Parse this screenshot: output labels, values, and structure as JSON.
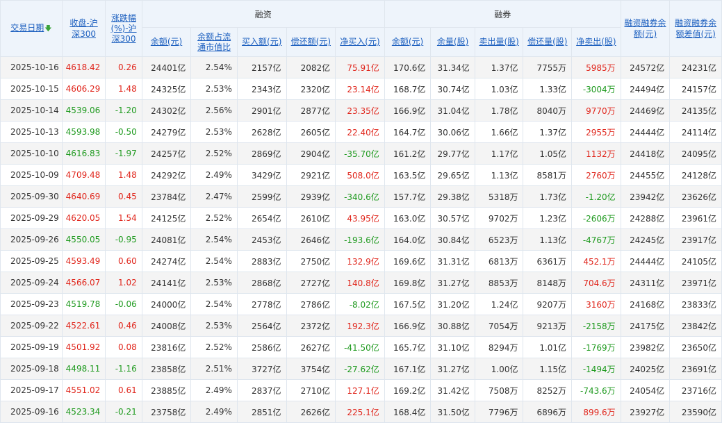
{
  "headers": {
    "date": "交易日期",
    "close": "收盘-沪深300",
    "change": "涨跌幅(%)-沪深300",
    "rz_group": "融资",
    "rq_group": "融券",
    "rzrq_balance": "融资融券余额(元)",
    "rzrq_diff": "融资融券余额差值(元)",
    "rz": [
      "余额(元)",
      "余额占流通市值比",
      "买入额(元)",
      "偿还额(元)",
      "净买入(元)"
    ],
    "rq": [
      "余额(元)",
      "余量(股)",
      "卖出量(股)",
      "偿还量(股)",
      "净卖出(股)"
    ]
  },
  "colors": {
    "up": "#e0251b",
    "down": "#1f9a1f",
    "link": "#1c5fbf"
  },
  "rows": [
    [
      "2025-10-16",
      "4618.42",
      "0.26",
      "24401亿",
      "2.54%",
      "2157亿",
      "2082亿",
      "75.91亿",
      "170.6亿",
      "31.34亿",
      "1.37亿",
      "7755万",
      "5985万",
      "24572亿",
      "24231亿"
    ],
    [
      "2025-10-15",
      "4606.29",
      "1.48",
      "24325亿",
      "2.53%",
      "2343亿",
      "2320亿",
      "23.14亿",
      "168.7亿",
      "30.74亿",
      "1.03亿",
      "1.33亿",
      "-3004万",
      "24494亿",
      "24157亿"
    ],
    [
      "2025-10-14",
      "4539.06",
      "-1.20",
      "24302亿",
      "2.56%",
      "2901亿",
      "2877亿",
      "23.35亿",
      "166.9亿",
      "31.04亿",
      "1.78亿",
      "8040万",
      "9770万",
      "24469亿",
      "24135亿"
    ],
    [
      "2025-10-13",
      "4593.98",
      "-0.50",
      "24279亿",
      "2.53%",
      "2628亿",
      "2605亿",
      "22.40亿",
      "164.7亿",
      "30.06亿",
      "1.66亿",
      "1.37亿",
      "2955万",
      "24444亿",
      "24114亿"
    ],
    [
      "2025-10-10",
      "4616.83",
      "-1.97",
      "24257亿",
      "2.52%",
      "2869亿",
      "2904亿",
      "-35.70亿",
      "161.2亿",
      "29.77亿",
      "1.17亿",
      "1.05亿",
      "1132万",
      "24418亿",
      "24095亿"
    ],
    [
      "2025-10-09",
      "4709.48",
      "1.48",
      "24292亿",
      "2.49%",
      "3429亿",
      "2921亿",
      "508.0亿",
      "163.5亿",
      "29.65亿",
      "1.13亿",
      "8581万",
      "2760万",
      "24455亿",
      "24128亿"
    ],
    [
      "2025-09-30",
      "4640.69",
      "0.45",
      "23784亿",
      "2.47%",
      "2599亿",
      "2939亿",
      "-340.6亿",
      "157.7亿",
      "29.38亿",
      "5318万",
      "1.73亿",
      "-1.20亿",
      "23942亿",
      "23626亿"
    ],
    [
      "2025-09-29",
      "4620.05",
      "1.54",
      "24125亿",
      "2.52%",
      "2654亿",
      "2610亿",
      "43.95亿",
      "163.0亿",
      "30.57亿",
      "9702万",
      "1.23亿",
      "-2606万",
      "24288亿",
      "23961亿"
    ],
    [
      "2025-09-26",
      "4550.05",
      "-0.95",
      "24081亿",
      "2.54%",
      "2453亿",
      "2646亿",
      "-193.6亿",
      "164.0亿",
      "30.84亿",
      "6523万",
      "1.13亿",
      "-4767万",
      "24245亿",
      "23917亿"
    ],
    [
      "2025-09-25",
      "4593.49",
      "0.60",
      "24274亿",
      "2.54%",
      "2883亿",
      "2750亿",
      "132.9亿",
      "169.6亿",
      "31.31亿",
      "6813万",
      "6361万",
      "452.1万",
      "24444亿",
      "24105亿"
    ],
    [
      "2025-09-24",
      "4566.07",
      "1.02",
      "24141亿",
      "2.53%",
      "2868亿",
      "2727亿",
      "140.8亿",
      "169.8亿",
      "31.27亿",
      "8853万",
      "8148万",
      "704.6万",
      "24311亿",
      "23971亿"
    ],
    [
      "2025-09-23",
      "4519.78",
      "-0.06",
      "24000亿",
      "2.54%",
      "2778亿",
      "2786亿",
      "-8.02亿",
      "167.5亿",
      "31.20亿",
      "1.24亿",
      "9207万",
      "3160万",
      "24168亿",
      "23833亿"
    ],
    [
      "2025-09-22",
      "4522.61",
      "0.46",
      "24008亿",
      "2.53%",
      "2564亿",
      "2372亿",
      "192.3亿",
      "166.9亿",
      "30.88亿",
      "7054万",
      "9213万",
      "-2158万",
      "24175亿",
      "23842亿"
    ],
    [
      "2025-09-19",
      "4501.92",
      "0.08",
      "23816亿",
      "2.52%",
      "2586亿",
      "2627亿",
      "-41.50亿",
      "165.7亿",
      "31.10亿",
      "8294万",
      "1.01亿",
      "-1769万",
      "23982亿",
      "23650亿"
    ],
    [
      "2025-09-18",
      "4498.11",
      "-1.16",
      "23858亿",
      "2.51%",
      "3727亿",
      "3754亿",
      "-27.62亿",
      "167.1亿",
      "31.27亿",
      "1.00亿",
      "1.15亿",
      "-1494万",
      "24025亿",
      "23691亿"
    ],
    [
      "2025-09-17",
      "4551.02",
      "0.61",
      "23885亿",
      "2.49%",
      "2837亿",
      "2710亿",
      "127.1亿",
      "169.2亿",
      "31.42亿",
      "7508万",
      "8252万",
      "-743.6万",
      "24054亿",
      "23716亿"
    ],
    [
      "2025-09-16",
      "4523.34",
      "-0.21",
      "23758亿",
      "2.49%",
      "2851亿",
      "2626亿",
      "225.1亿",
      "168.4亿",
      "31.50亿",
      "7796万",
      "6896万",
      "899.6万",
      "23927亿",
      "23590亿"
    ]
  ]
}
